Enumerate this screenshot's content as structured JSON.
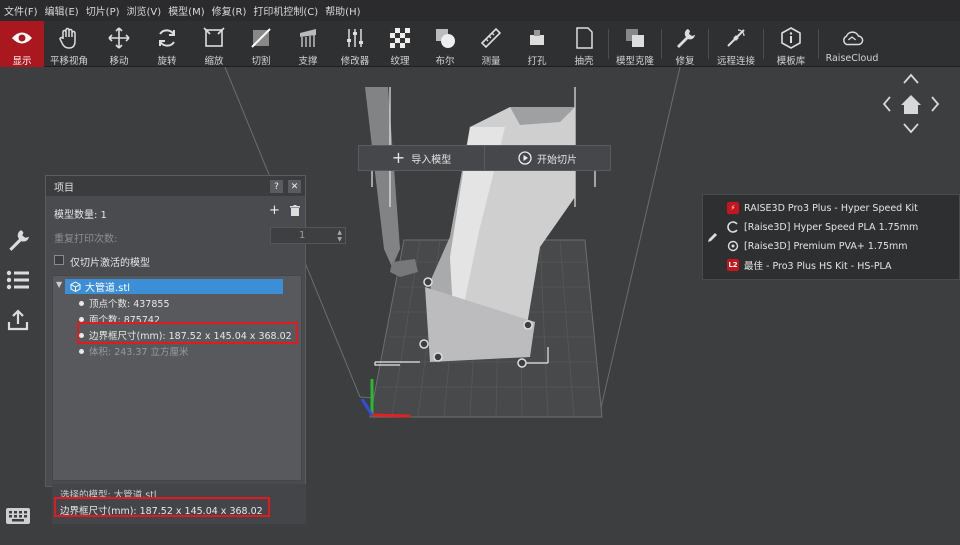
{
  "menu": [
    "文件(F)",
    "编辑(E)",
    "切片(P)",
    "浏览(V)",
    "模型(M)",
    "修复(R)",
    "打印机控制(C)",
    "帮助(H)"
  ],
  "toolbar": [
    {
      "label": "显示",
      "icon": "eye-icon"
    },
    {
      "label": "平移视角",
      "icon": "hand-icon"
    },
    {
      "label": "移动",
      "icon": "move-icon"
    },
    {
      "label": "旋转",
      "icon": "rotate-icon"
    },
    {
      "label": "缩放",
      "icon": "scale-icon"
    },
    {
      "label": "切割",
      "icon": "cut-icon"
    },
    {
      "label": "支撑",
      "icon": "support-icon"
    },
    {
      "label": "修改器",
      "icon": "modifier-icon"
    },
    {
      "label": "纹理",
      "icon": "texture-icon"
    },
    {
      "label": "布尔",
      "icon": "boolean-icon"
    },
    {
      "label": "测量",
      "icon": "ruler-icon"
    },
    {
      "label": "打孔",
      "icon": "hole-icon"
    },
    {
      "label": "抽壳",
      "icon": "shell-icon"
    },
    {
      "label": "模型克隆",
      "icon": "clone-icon"
    },
    {
      "label": "修复",
      "icon": "wrench-icon"
    },
    {
      "label": "远程连接",
      "icon": "remote-icon"
    },
    {
      "label": "模板库",
      "icon": "info-icon"
    },
    {
      "label": "RaiseCloud",
      "icon": "cloud-icon"
    }
  ],
  "viewport": {
    "import_label": "导入模型",
    "slice_label": "开始切片"
  },
  "project": {
    "title": "项目",
    "help": "?",
    "close": "✕",
    "model_count_label": "模型数量: 1",
    "add": "+",
    "repeat_label": "重复打印次数:",
    "repeat_value": "1",
    "only_active_label": "仅切片激活的模型",
    "file_name": "大管道.stl",
    "details": [
      "顶点个数: 437855",
      "面个数: 875742",
      "边界框尺寸(mm): 187.52 x 145.04 x 368.02",
      "体积: 243.37 立方厘米"
    ]
  },
  "status": {
    "selected": "选择的模型: 大管道.stl",
    "bbox": "边界框尺寸(mm): 187.52 x 145.04 x 368.02"
  },
  "profile": {
    "items": [
      {
        "text": "RAISE3D Pro3 Plus - Hyper Speed Kit",
        "icon": "bolt-icon"
      },
      {
        "text": "[Raise3D] Hyper Speed PLA 1.75mm",
        "icon": "filament-icon"
      },
      {
        "text": "[Raise3D] Premium PVA+ 1.75mm",
        "icon": "filament-icon"
      },
      {
        "text": "最佳 - Pro3 Plus HS Kit - HS-PLA",
        "icon": "l2-badge-icon",
        "badge": "L2"
      }
    ]
  },
  "colors": {
    "accent": "#a8181e",
    "highlight": "#3c8ed6",
    "annotation": "#e2191f"
  }
}
